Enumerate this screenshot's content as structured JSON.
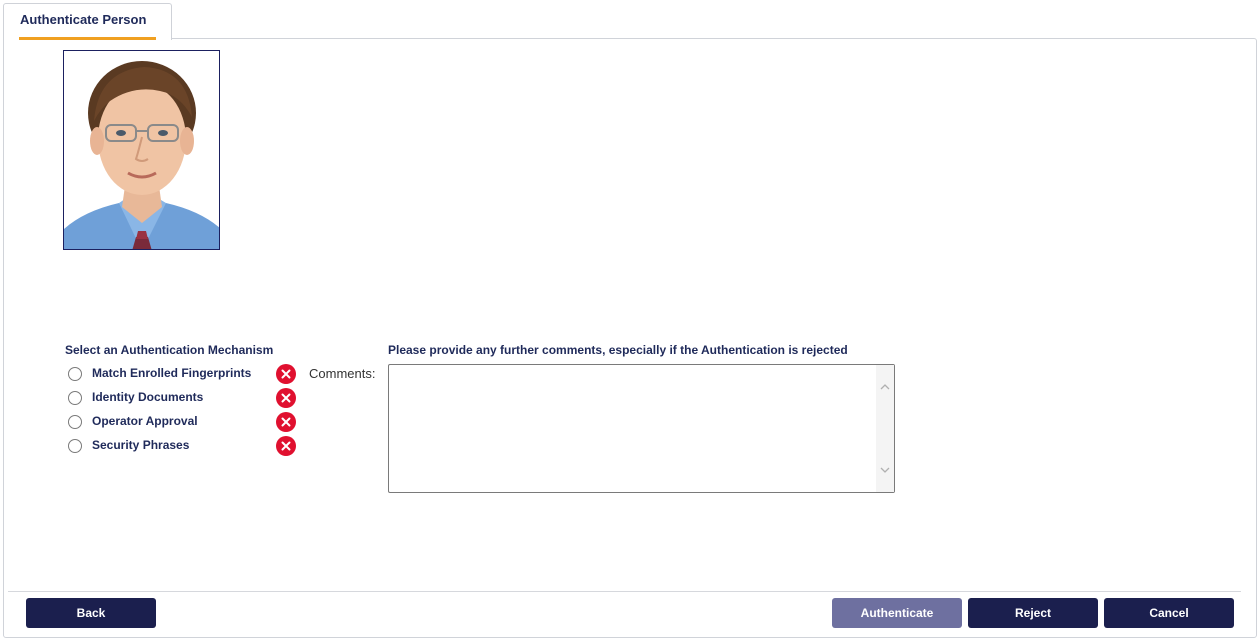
{
  "tab": {
    "label": "Authenticate Person",
    "accent_color": "#f0a020"
  },
  "photo": {
    "alt": "Person photo"
  },
  "mechanism": {
    "title": "Select an Authentication Mechanism",
    "items": [
      {
        "label": "Match Enrolled Fingerprints",
        "status_icon": "error-x-icon"
      },
      {
        "label": "Identity Documents",
        "status_icon": "error-x-icon"
      },
      {
        "label": "Operator Approval",
        "status_icon": "error-x-icon"
      },
      {
        "label": "Security Phrases",
        "status_icon": "error-x-icon"
      }
    ],
    "status_color": "#e0102f"
  },
  "comments": {
    "hint": "Please provide any further comments, especially if the Authentication is rejected",
    "label": "Comments:",
    "value": ""
  },
  "footer": {
    "back_label": "Back",
    "authenticate_label": "Authenticate",
    "reject_label": "Reject",
    "cancel_label": "Cancel",
    "button_color": "#1b1f4e",
    "disabled_button_color": "#6e70a0"
  }
}
